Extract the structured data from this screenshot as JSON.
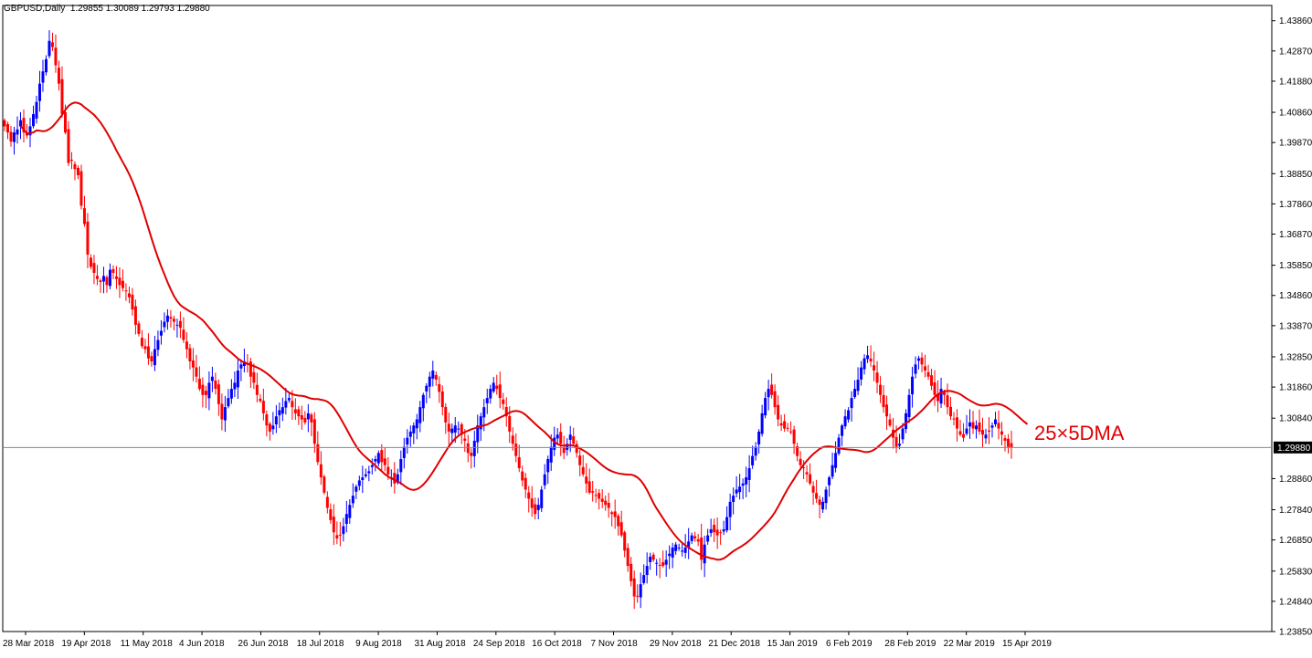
{
  "chart_data": {
    "type": "candlestick",
    "symbol": "GBPUSD,Daily",
    "ohlc": {
      "open": "1.29855",
      "high": "1.30089",
      "low": "1.29793",
      "close": "1.29880"
    },
    "title_values": "1.29855 1.30089 1.29793 1.29880",
    "current_price": 1.2988,
    "current_price_label": "1.29880",
    "annotation": "25×5DMA",
    "ylim": [
      1.2385,
      1.4436
    ],
    "y_ticks": [
      "1.43860",
      "1.42870",
      "1.41880",
      "1.40860",
      "1.39870",
      "1.38850",
      "1.37860",
      "1.36870",
      "1.35850",
      "1.34860",
      "1.33870",
      "1.32850",
      "1.31860",
      "1.30840",
      "1.29880",
      "1.28860",
      "1.27840",
      "1.26850",
      "1.25830",
      "1.24840",
      "1.23850"
    ],
    "x_ticks": [
      "28 Mar 2018",
      "19 Apr 2018",
      "11 May 2018",
      "4 Jun 2018",
      "26 Jun 2018",
      "18 Jul 2018",
      "9 Aug 2018",
      "31 Aug 2018",
      "24 Sep 2018",
      "16 Oct 2018",
      "7 Nov 2018",
      "29 Nov 2018",
      "21 Dec 2018",
      "15 Jan 2019",
      "6 Feb 2019",
      "28 Feb 2019",
      "22 Mar 2019",
      "15 Apr 2019"
    ],
    "closes": [
      1.404,
      1.402,
      1.399,
      1.402,
      1.403,
      1.406,
      1.402,
      1.401,
      1.404,
      1.408,
      1.412,
      1.418,
      1.422,
      1.426,
      1.432,
      1.43,
      1.424,
      1.418,
      1.408,
      1.402,
      1.392,
      1.393,
      1.39,
      1.388,
      1.378,
      1.372,
      1.362,
      1.358,
      1.356,
      1.354,
      1.353,
      1.355,
      1.352,
      1.357,
      1.356,
      1.354,
      1.352,
      1.351,
      1.35,
      1.348,
      1.344,
      1.339,
      1.336,
      1.332,
      1.331,
      1.328,
      1.327,
      1.331,
      1.334,
      1.337,
      1.34,
      1.342,
      1.341,
      1.34,
      1.339,
      1.338,
      1.334,
      1.331,
      1.327,
      1.325,
      1.322,
      1.318,
      1.316,
      1.316,
      1.32,
      1.322,
      1.318,
      1.313,
      1.308,
      1.312,
      1.315,
      1.318,
      1.32,
      1.324,
      1.326,
      1.327,
      1.326,
      1.322,
      1.32,
      1.316,
      1.314,
      1.31,
      1.306,
      1.304,
      1.306,
      1.309,
      1.311,
      1.312,
      1.314,
      1.315,
      1.312,
      1.31,
      1.309,
      1.308,
      1.307,
      1.31,
      1.307,
      1.3,
      1.294,
      1.289,
      1.284,
      1.279,
      1.275,
      1.271,
      1.269,
      1.27,
      1.273,
      1.277,
      1.28,
      1.283,
      1.286,
      1.288,
      1.289,
      1.29,
      1.291,
      1.293,
      1.295,
      1.297,
      1.294,
      1.293,
      1.29,
      1.289,
      1.287,
      1.29,
      1.295,
      1.299,
      1.302,
      1.304,
      1.306,
      1.308,
      1.312,
      1.316,
      1.319,
      1.322,
      1.324,
      1.321,
      1.317,
      1.312,
      1.307,
      1.304,
      1.305,
      1.306,
      1.305,
      1.303,
      1.301,
      1.297,
      1.296,
      1.301,
      1.306,
      1.309,
      1.312,
      1.315,
      1.318,
      1.32,
      1.318,
      1.315,
      1.313,
      1.309,
      1.304,
      1.3,
      1.296,
      1.292,
      1.288,
      1.285,
      1.282,
      1.279,
      1.277,
      1.28,
      1.285,
      1.29,
      1.295,
      1.299,
      1.302,
      1.303,
      1.3,
      1.297,
      1.3,
      1.303,
      1.3,
      1.297,
      1.293,
      1.29,
      1.287,
      1.284,
      1.284,
      1.283,
      1.282,
      1.281,
      1.28,
      1.279,
      1.277,
      1.276,
      1.273,
      1.27,
      1.265,
      1.26,
      1.255,
      1.25,
      1.25,
      1.254,
      1.257,
      1.26,
      1.263,
      1.262,
      1.261,
      1.26,
      1.26,
      1.262,
      1.264,
      1.266,
      1.267,
      1.266,
      1.265,
      1.266,
      1.268,
      1.27,
      1.269,
      1.268,
      1.262,
      1.267,
      1.27,
      1.272,
      1.271,
      1.27,
      1.271,
      1.272,
      1.276,
      1.281,
      1.283,
      1.285,
      1.286,
      1.287,
      1.289,
      1.292,
      1.296,
      1.299,
      1.304,
      1.31,
      1.315,
      1.318,
      1.316,
      1.312,
      1.308,
      1.306,
      1.305,
      1.305,
      1.304,
      1.3,
      1.296,
      1.293,
      1.292,
      1.29,
      1.287,
      1.284,
      1.282,
      1.28,
      1.281,
      1.285,
      1.289,
      1.293,
      1.297,
      1.302,
      1.306,
      1.309,
      1.311,
      1.315,
      1.318,
      1.321,
      1.325,
      1.328,
      1.329,
      1.327,
      1.324,
      1.32,
      1.316,
      1.312,
      1.309,
      1.306,
      1.302,
      1.299,
      1.3,
      1.305,
      1.31,
      1.316,
      1.322,
      1.326,
      1.328,
      1.326,
      1.324,
      1.322,
      1.319,
      1.316,
      1.314,
      1.318,
      1.316,
      1.312,
      1.309,
      1.308,
      1.305,
      1.303,
      1.302,
      1.305,
      1.307,
      1.305,
      1.306,
      1.304,
      1.303,
      1.303,
      1.304,
      1.306,
      1.308,
      1.305,
      1.303,
      1.301,
      1.299,
      1.2988
    ]
  }
}
